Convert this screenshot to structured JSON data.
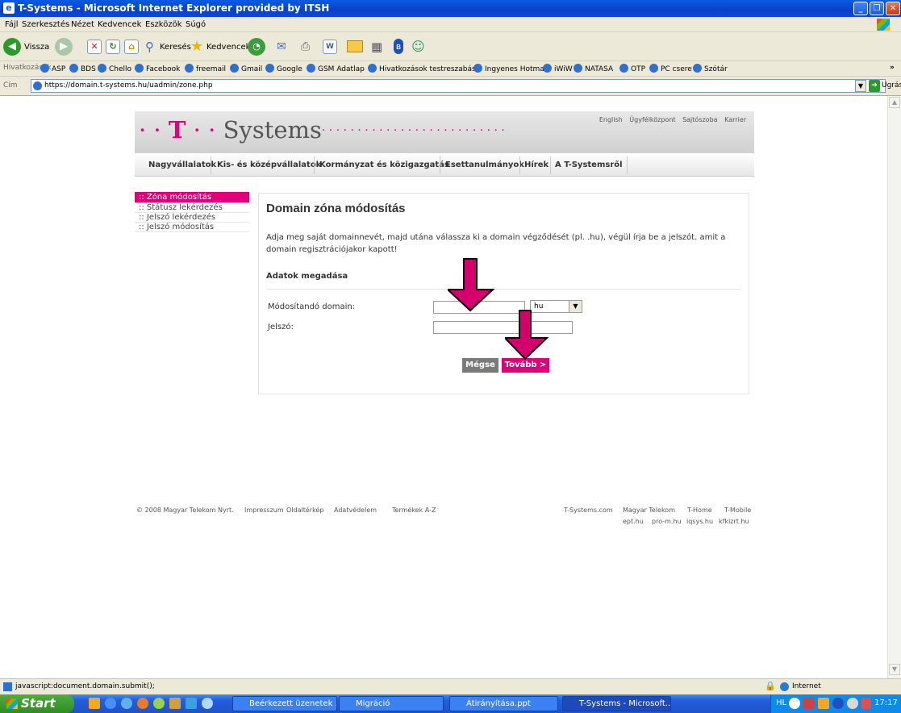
{
  "window": {
    "title": "T-Systems - Microsoft Internet Explorer provided by ITSH"
  },
  "menu": [
    "Fájl",
    "Szerkesztés",
    "Nézet",
    "Kedvencek",
    "Eszközök",
    "Súgó"
  ],
  "toolbar": {
    "back": "Vissza",
    "search": "Keresés",
    "favorites": "Kedvencek"
  },
  "links": {
    "label": "Hivatkozások",
    "items": [
      "ASP",
      "BDS",
      "Chello",
      "Facebook",
      "freemail",
      "Gmail",
      "Google",
      "GSM Adatlap",
      "Hivatkozások testreszabása",
      "Ingyenes Hotmail",
      "iWiW",
      "NATASA",
      "OTP",
      "PC csere",
      "Szótár"
    ]
  },
  "address": {
    "label": "Cím",
    "url": "https://domain.t-systems.hu/uadmin/zone.php",
    "go": "Ugrás"
  },
  "page": {
    "logo": {
      "left_dots": "· · ",
      "t": "T",
      "mid_dots": " · · ",
      "name": "Systems",
      "trail": "· · · · · · · · · · · · · · · · · · · · · · · · · ·"
    },
    "topnav": [
      "English",
      "Ügyfélközpont",
      "Sajtószoba",
      "Karrier"
    ],
    "mainnav": [
      "Nagyvállalatok",
      "Kis- és középvállalatok",
      "Kormányzat és közigazgatás",
      "Esettanulmányok",
      "Hírek",
      "A T-Systemsről"
    ],
    "leftnav": [
      ":: Zóna módosítás",
      ":: Státusz lekérdezés",
      ":: Jelszó lekérdezés",
      ":: Jelszó módosítás"
    ],
    "heading": "Domain zóna módosítás",
    "intro": "Adja meg saját domainnevét, majd utána válassza ki a domain végződését (pl. .hu), végül írja be a jelszót. amit a domain regisztrációjakor kapott!",
    "section": "Adatok megadása",
    "form": {
      "domain_label": "Módosítandó domain:",
      "domain_value": "",
      "tld_value": "hu",
      "password_label": "Jelszó:",
      "password_value": ""
    },
    "buttons": {
      "cancel": "Mégse",
      "next": "Tovább >"
    },
    "footer": {
      "copyright": "© 2008 Magyar Telekom Nyrt.",
      "links": [
        "Impresszum",
        "Oldaltérkép",
        "Adatvédelem",
        "Termékek A-Z"
      ],
      "right1": [
        "T-Systems.com",
        "Magyar Telekom",
        "T-Home",
        "T-Mobile"
      ],
      "right2": [
        "ept.hu",
        "pro-m.hu",
        "iqsys.hu",
        "kfkizrt.hu"
      ]
    }
  },
  "status": {
    "text": "javascript:document.domain.submit();",
    "zone": "Internet"
  },
  "taskbar": {
    "start": "Start",
    "tasks": [
      "Beérkezett üzenetek ...",
      "Migráció",
      "Átirányítása.ppt",
      "T-Systems - Microsoft..."
    ],
    "tray_lang": "HL",
    "clock": "17:17"
  },
  "colors": {
    "brand": "#e2007a",
    "annotation_arrow": "#d4006e"
  }
}
